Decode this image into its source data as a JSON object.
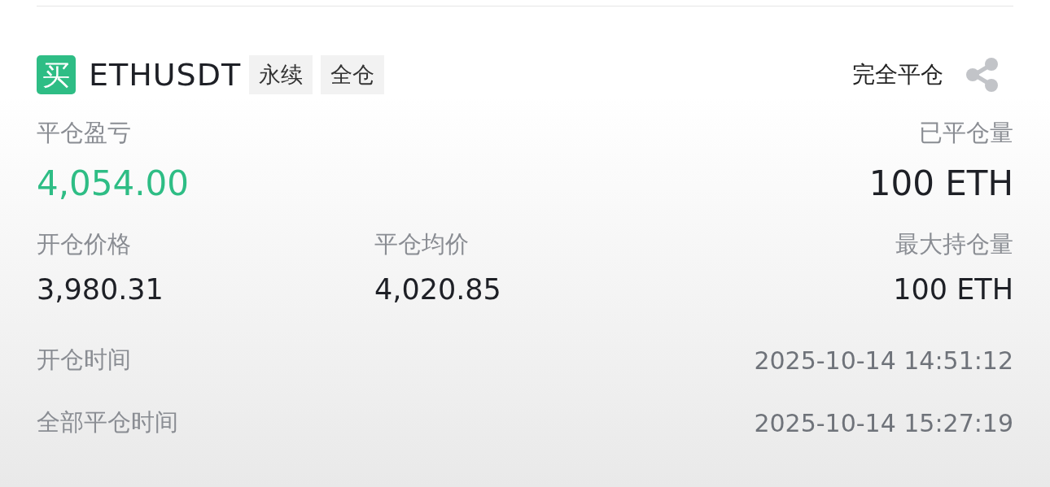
{
  "order": {
    "side": {
      "label": "买",
      "kind": "buy"
    },
    "symbol": "ETHUSDT",
    "tags": [
      "永续",
      "全仓"
    ],
    "status": "完全平仓"
  },
  "pnl": {
    "label": "平仓盈亏",
    "value": "4,054.00",
    "positive": true
  },
  "closed_volume": {
    "label": "已平仓量",
    "value": "100 ETH"
  },
  "open_price": {
    "label": "开仓价格",
    "value": "3,980.31"
  },
  "close_avg_price": {
    "label": "平仓均价",
    "value": "4,020.85"
  },
  "max_position": {
    "label": "最大持仓量",
    "value": "100 ETH"
  },
  "times": [
    {
      "label": "开仓时间",
      "value": "2025-10-14 14:51:12"
    },
    {
      "label": "全部平仓时间",
      "value": "2025-10-14 15:27:19"
    }
  ]
}
